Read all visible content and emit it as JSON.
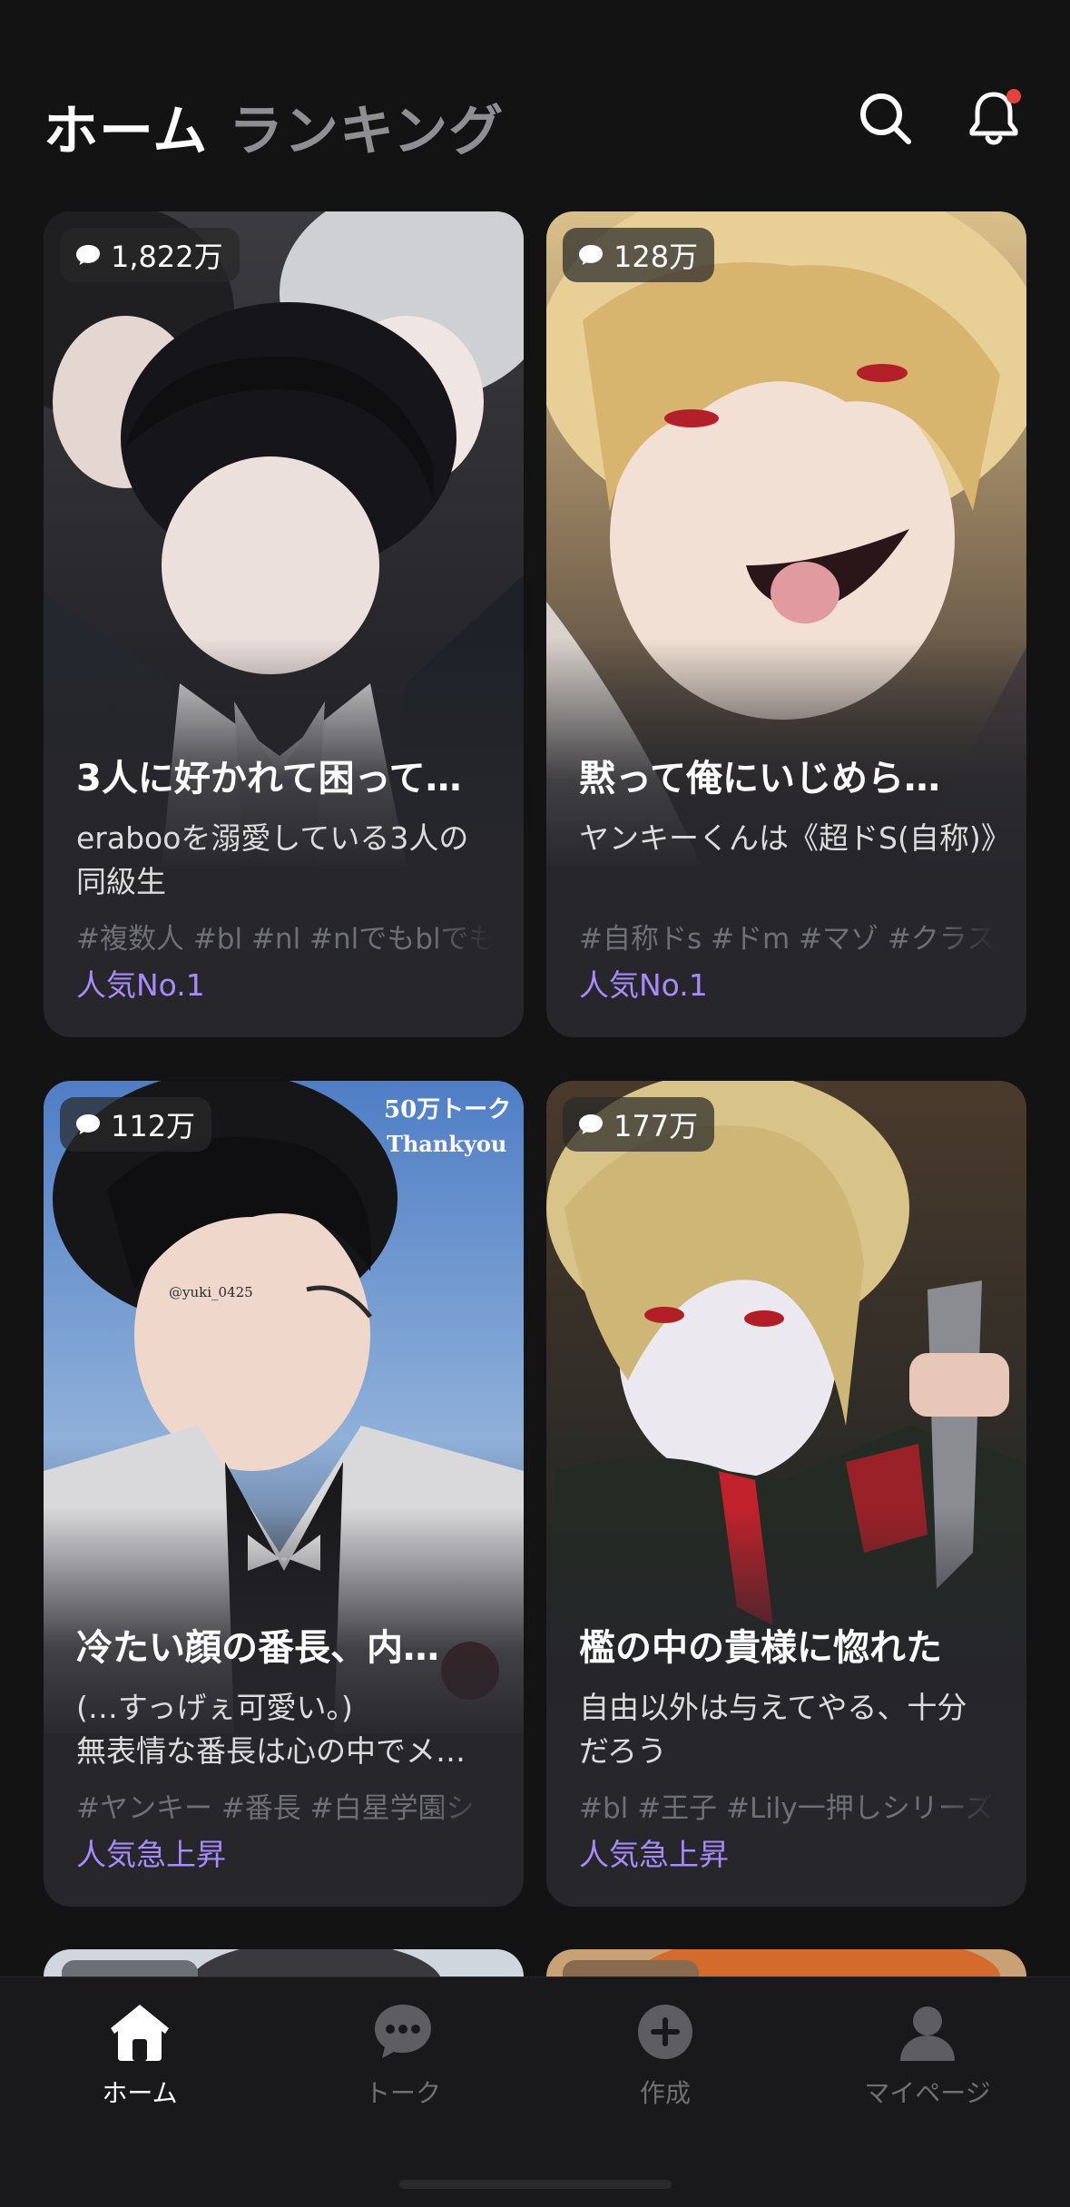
{
  "header": {
    "tabs": [
      {
        "label": "ホーム",
        "active": true
      },
      {
        "label": "ランキング",
        "active": false
      }
    ],
    "search_icon": "search-icon",
    "bell_icon": "bell-icon",
    "has_notification": true
  },
  "cards": [
    {
      "count": "1,822万",
      "title": "3人に好かれて困って…",
      "description": "erabooを溺愛している3人の同級生",
      "tags": "#複数人 #bl #nl #nlでもblでも",
      "rank_label": "人気No.1"
    },
    {
      "count": "128万",
      "title": "黙って俺にいじめら…",
      "description": "ヤンキーくんは《超ドS(自称)》",
      "tags": "#自称ドs #ドm #マゾ #クラス",
      "rank_label": "人気No.1"
    },
    {
      "count": "112万",
      "title": "冷たい顔の番長、内…",
      "description": "(…すっげぇ可愛い。)\n無表情な番長は心の中でメ…",
      "tags": "#ヤンキー #番長 #白星学園シ",
      "rank_label": "人気急上昇",
      "art_text": [
        "50万トーク",
        "Thankyou",
        "@yuki_0425"
      ]
    },
    {
      "count": "177万",
      "title": "檻の中の貴様に惚れた",
      "description": "自由以外は与えてやる、十分だろう",
      "tags": "#bl #王子 #Lily一押しシリーズ",
      "rank_label": "人気急上昇"
    }
  ],
  "bottom_nav": [
    {
      "label": "ホーム",
      "icon": "home-icon",
      "active": true
    },
    {
      "label": "トーク",
      "icon": "chat-icon",
      "active": false
    },
    {
      "label": "作成",
      "icon": "plus-circle-icon",
      "active": false
    },
    {
      "label": "マイページ",
      "icon": "person-icon",
      "active": false
    }
  ],
  "colors": {
    "background": "#131314",
    "card": "#26262b",
    "accent": "#a78bfa",
    "notification_dot": "#e5423d",
    "inactive": "#8e8e93"
  }
}
